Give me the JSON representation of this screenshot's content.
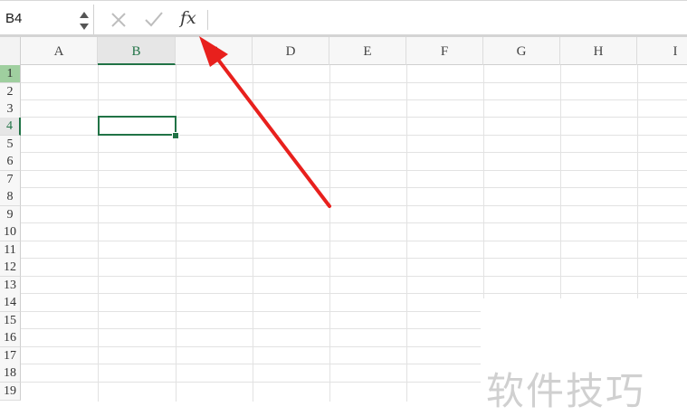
{
  "formula_bar": {
    "name_box": "B4",
    "cancel_icon": "close-icon",
    "confirm_icon": "check-icon",
    "fx_label": "fx",
    "formula_value": ""
  },
  "columns": [
    "A",
    "B",
    "C",
    "D",
    "E",
    "F",
    "G",
    "H",
    "I"
  ],
  "rows": [
    "1",
    "2",
    "3",
    "4",
    "5",
    "6",
    "7",
    "8",
    "9",
    "10",
    "11",
    "12",
    "13",
    "14",
    "15",
    "16",
    "17",
    "18",
    "19"
  ],
  "selected_cell": "B4",
  "colors": {
    "accent": "#217346",
    "first_row_header": "#9fcf9f",
    "annotation_arrow": "#e8201d",
    "watermark": "#d0d0d0"
  },
  "watermark": "软件技巧"
}
